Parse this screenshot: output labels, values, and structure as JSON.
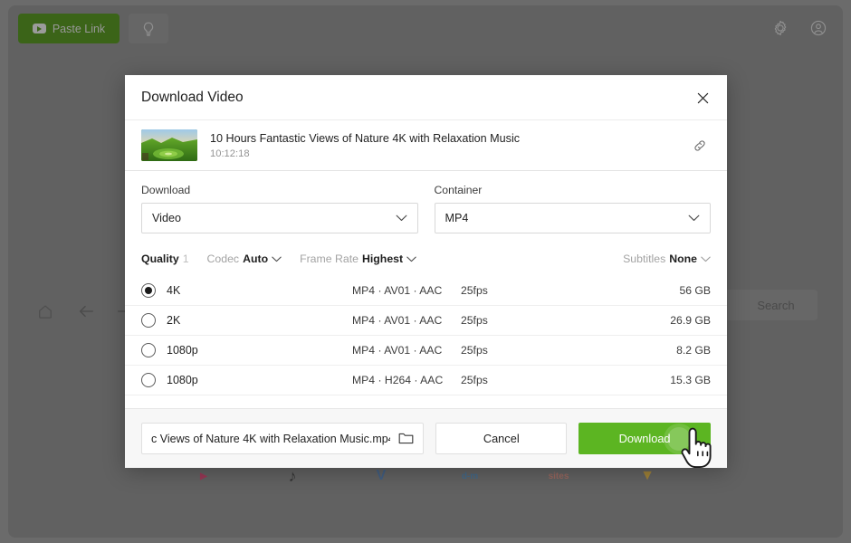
{
  "window": {
    "toolbar": {
      "paste_link_label": "Paste Link",
      "paste_link_icon": "youtube-icon",
      "bulb_icon": "lightbulb-icon",
      "settings_icon": "gear-icon",
      "account_icon": "account-circle-icon"
    },
    "nav": {
      "home_icon": "home-icon",
      "back_icon": "arrow-left-icon",
      "forward_icon": "arrow-right-icon",
      "search_label": "Search"
    },
    "logos": [
      {
        "name": "youtube-logo",
        "text": "▶",
        "color": "#c4184c"
      },
      {
        "name": "tiktok-logo",
        "text": "♪",
        "color": "#0f0f0f"
      },
      {
        "name": "vimeo-logo",
        "text": "V",
        "color": "#2a5c9b"
      },
      {
        "name": "dailymotion-logo",
        "text": "d-m",
        "color": "#2a6ea8"
      },
      {
        "name": "sites-logo",
        "text": "sites",
        "color": "#c06a5a"
      },
      {
        "name": "more-logo",
        "text": "▼",
        "color": "#d19a16"
      }
    ]
  },
  "modal": {
    "title": "Download Video",
    "close_icon": "close-icon",
    "video": {
      "title": "10 Hours Fantastic Views of Nature 4K with Relaxation Music",
      "duration": "10:12:18",
      "link_icon": "link-chain-icon",
      "thumbnail_icon": "video-thumbnail"
    },
    "download_field": {
      "label": "Download",
      "value": "Video",
      "chevron_icon": "chevron-down-icon"
    },
    "container_field": {
      "label": "Container",
      "value": "MP4",
      "chevron_icon": "chevron-down-icon"
    },
    "filters": {
      "quality_label": "Quality",
      "quality_count": "1",
      "codec_label": "Codec",
      "codec_value": "Auto",
      "frame_rate_label": "Frame Rate",
      "frame_rate_value": "Highest",
      "subtitles_label": "Subtitles",
      "subtitles_value": "None",
      "chevron_icon": "chevron-down-icon"
    },
    "quality_rows": [
      {
        "name": "4K",
        "codec": "MP4 · AV01 · AAC",
        "fps": "25fps",
        "size": "56 GB",
        "selected": true
      },
      {
        "name": "2K",
        "codec": "MP4 · AV01 · AAC",
        "fps": "25fps",
        "size": "26.9 GB",
        "selected": false
      },
      {
        "name": "1080p",
        "codec": "MP4 · AV01 · AAC",
        "fps": "25fps",
        "size": "8.2 GB",
        "selected": false
      },
      {
        "name": "1080p",
        "codec": "MP4 · H264 · AAC",
        "fps": "25fps",
        "size": "15.3 GB",
        "selected": false
      }
    ],
    "footer": {
      "filename_value": "c Views of Nature 4K with Relaxation Music.mp4",
      "folder_icon": "folder-icon",
      "cancel_label": "Cancel",
      "download_label": "Download"
    }
  },
  "colors": {
    "accent_green": "#5cb522",
    "overlay": "#616161",
    "modal_bg": "#ffffff",
    "footer_bg": "#f7f7f7"
  }
}
